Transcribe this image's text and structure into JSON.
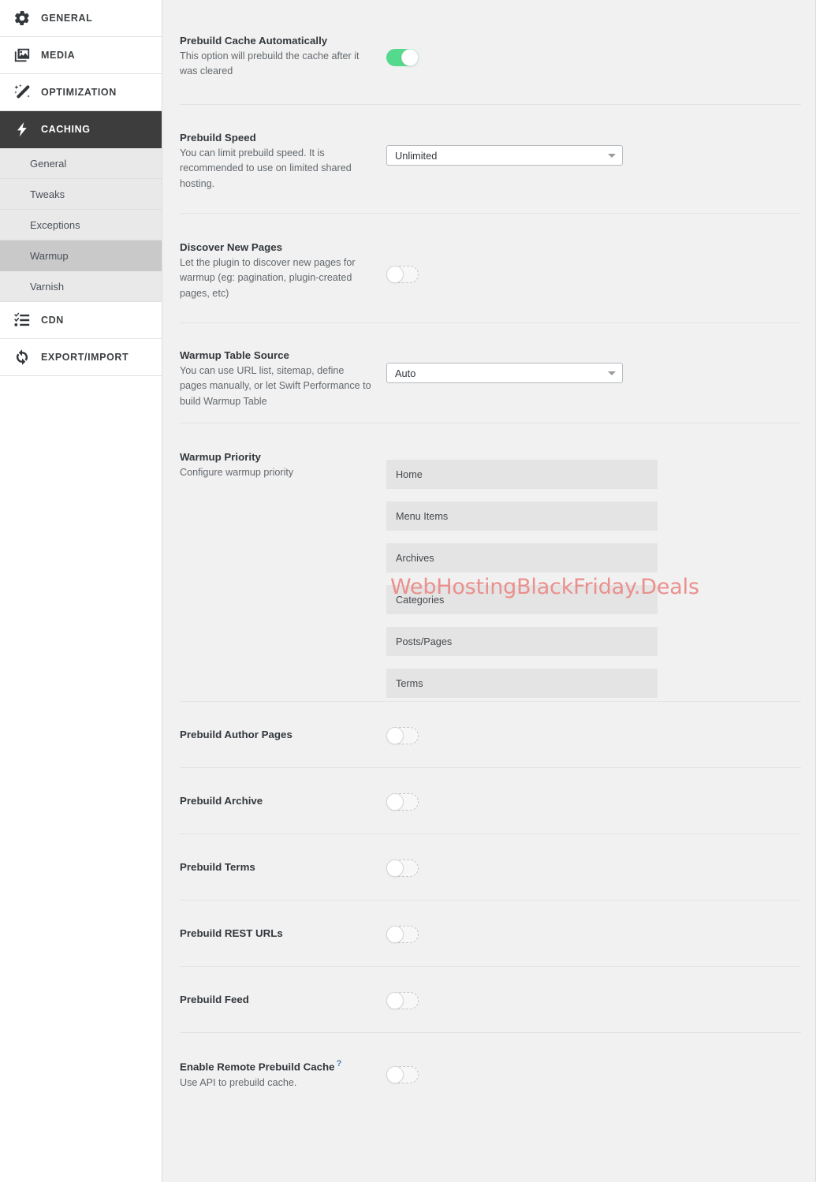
{
  "sidebar": {
    "main_items": [
      {
        "label": "GENERAL",
        "icon": "gear-icon",
        "active": false
      },
      {
        "label": "MEDIA",
        "icon": "images-icon",
        "active": false
      },
      {
        "label": "OPTIMIZATION",
        "icon": "magic-wand-icon",
        "active": false
      },
      {
        "label": "CACHING",
        "icon": "lightning-bolt-icon",
        "active": true
      }
    ],
    "sub_items": [
      {
        "label": "General",
        "active": false
      },
      {
        "label": "Tweaks",
        "active": false
      },
      {
        "label": "Exceptions",
        "active": false
      },
      {
        "label": "Warmup",
        "active": true
      },
      {
        "label": "Varnish",
        "active": false
      }
    ],
    "trailing_items": [
      {
        "label": "CDN",
        "icon": "checklist-icon",
        "active": false
      },
      {
        "label": "EXPORT/IMPORT",
        "icon": "refresh-cycle-icon",
        "active": false
      }
    ]
  },
  "colors": {
    "accent_on": "#55d98d",
    "active_nav_bg": "#3d3d3d",
    "active_subnav_bg": "#c9c9c9",
    "content_bg": "#f1f1f1",
    "priority_item_bg": "#e4e4e4",
    "help_icon": "#4a7fb5",
    "watermark": "#ea908d"
  },
  "watermark": "WebHostingBlackFriday.Deals",
  "settings": [
    {
      "name": "prebuild-cache-automatically",
      "title": "Prebuild Cache Automatically",
      "desc": "This option will prebuild the cache after it was cleared",
      "control": "toggle",
      "value": "on"
    },
    {
      "name": "prebuild-speed",
      "title": "Prebuild Speed",
      "desc": "You can limit prebuild speed. It is recommended to use on limited shared hosting.",
      "control": "select",
      "value": "Unlimited",
      "options": [
        "Unlimited"
      ]
    },
    {
      "name": "discover-new-pages",
      "title": "Discover New Pages",
      "desc": "Let the plugin to discover new pages for warmup (eg: pagination, plugin-created pages, etc)",
      "control": "toggle",
      "value": "off"
    },
    {
      "name": "warmup-table-source",
      "title": "Warmup Table Source",
      "desc": "You can use URL list, sitemap, define pages manually, or let Swift Performance to build Warmup Table",
      "control": "select",
      "value": "Auto",
      "options": [
        "Auto"
      ]
    },
    {
      "name": "warmup-priority",
      "title": "Warmup Priority",
      "desc": "Configure warmup priority",
      "control": "priority-list",
      "items": [
        "Home",
        "Menu Items",
        "Archives",
        "Categories",
        "Posts/Pages",
        "Terms"
      ]
    },
    {
      "name": "prebuild-author-pages",
      "title": "Prebuild Author Pages",
      "desc": "",
      "control": "toggle",
      "value": "off"
    },
    {
      "name": "prebuild-archive",
      "title": "Prebuild Archive",
      "desc": "",
      "control": "toggle",
      "value": "off"
    },
    {
      "name": "prebuild-terms",
      "title": "Prebuild Terms",
      "desc": "",
      "control": "toggle",
      "value": "off"
    },
    {
      "name": "prebuild-rest-urls",
      "title": "Prebuild REST URLs",
      "desc": "",
      "control": "toggle",
      "value": "off"
    },
    {
      "name": "prebuild-feed",
      "title": "Prebuild Feed",
      "desc": "",
      "control": "toggle",
      "value": "off"
    },
    {
      "name": "enable-remote-prebuild-cache",
      "title": "Enable Remote Prebuild Cache",
      "help": "?",
      "desc": "Use API to prebuild cache.",
      "control": "toggle",
      "value": "off"
    }
  ]
}
